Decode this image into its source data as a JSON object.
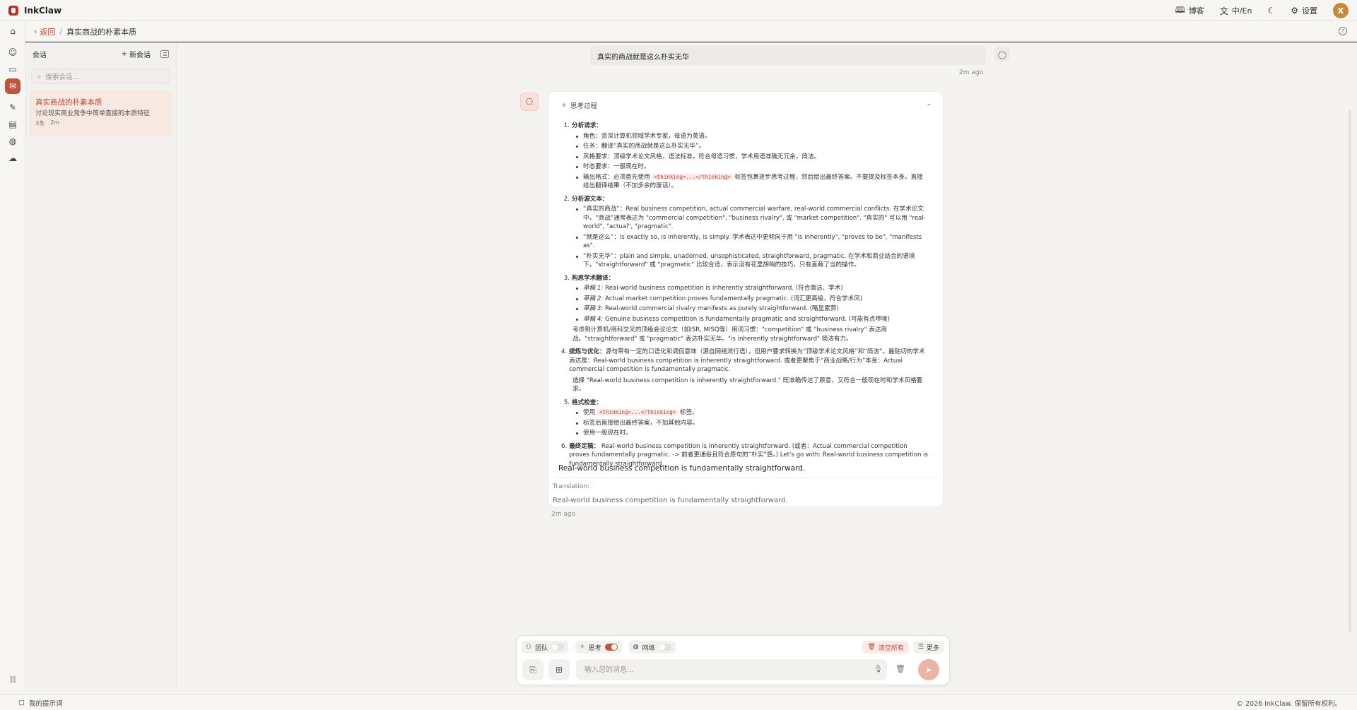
{
  "app": {
    "name": "InkClaw"
  },
  "topbar": {
    "blog_label": "博客",
    "lang_label": "中/En",
    "settings_label": "设置",
    "avatar_initial": "X"
  },
  "breadcrumb": {
    "back_label": "返回",
    "separator": "/",
    "title": "真实商战的朴素本质"
  },
  "sessions": {
    "header": "会话",
    "new_label": "新会话",
    "search_placeholder": "搜索会话...",
    "items": [
      {
        "title": "真实商战的朴素本质",
        "desc": "讨论现实商业竞争中简单直接的本质特征",
        "count": "3条",
        "time": "2m"
      }
    ]
  },
  "chat": {
    "user_message": "真实的商战就是这么朴实无华",
    "user_time": "2m ago",
    "thinking_label": "思考过程",
    "thinking": {
      "s1_title": "分析请求：",
      "s1_items": [
        "角色：资深计算机领域学术专家，母语为英语。",
        "任务：翻译“真实的商战就是这么朴实无华”。",
        "风格要求：顶级学术论文风格，语法标准，符合母语习惯，学术用语准确无冗余，简洁。",
        "时态要求：一般现在时。"
      ],
      "s1_fmt_a": "输出格式：必须首先使用",
      "s1_fmt_tag": "<thinking>...</thinking>",
      "s1_fmt_b": "标签包裹逐步思考过程，然后给出最终答案。不要提及标签本身。直接给出翻译结果（不加多余的废话）。",
      "s2_title": "分析源文本：",
      "s2_items": [
        "“真实的商战”：Real business competition, actual commercial warfare, real-world commercial conflicts. 在学术论文中，“商战”通常表达为 \"commercial competition\", \"business rivalry\", 或 \"market competition\". \"真实的\" 可以用 \"real-world\", \"actual\", \"pragmatic\".",
        "“就是这么”：is exactly so, is inherently, is simply. 学术表达中更倾向于用 \"is inherently\", \"proves to be\", \"manifests as\".",
        "“朴实无华”：plain and simple, unadorned, unsophisticated, straightforward, pragmatic. 在学术和商业结合的语境下，\"straightforward\" 或 \"pragmatic\" 比较合适，表示没有花里胡哨的技巧，只有直截了当的操作。"
      ],
      "s3_title": "构思学术翻译：",
      "s3_items": [
        {
          "tag": "草稿 1:",
          "text": "Real-world business competition is inherently straightforward. (符合简洁、学术)"
        },
        {
          "tag": "草稿 2:",
          "text": "Actual market competition proves fundamentally pragmatic. (词汇更高级，符合学术风)"
        },
        {
          "tag": "草稿 3:",
          "text": "Real-world commercial rivalry manifests as purely straightforward. (略显累赘)"
        },
        {
          "tag": "草稿 4:",
          "text": "Genuine business competition is fundamentally pragmatic and straightforward. (可能有点啰嗦)"
        }
      ],
      "s3_para": "考虑到计算机/商科交叉的顶级会议论文（如ISR, MISQ等）用词习惯：\"competition\" 或 \"business rivalry\" 表达商战。\"straightforward\" 或 \"pragmatic\" 表达朴实无华。\"is inherently straightforward\" 简洁有力。",
      "s4_title": "提炼与优化：",
      "s4_text": "源句带有一定的口语化和调侃意味（源自网络流行语），但用户要求转换为“顶级学术论文风格”和“简洁”。最贴切的学术表达是：Real-world business competition is inherently straightforward. 或者更聚焦于“商业战略/行为”本身：Actual commercial competition is fundamentally pragmatic.",
      "s4_para": "选择 \"Real-world business competition is inherently straightforward.\" 既准确传达了原意，又符合一般现在时和学术风格要求。",
      "s5_title": "格式检查：",
      "s5_item1_a": "使用",
      "s5_item1_tag": "<thinking>...</thinking>",
      "s5_item1_b": "标签。",
      "s5_items": [
        "标签后直接给出最终答案，不加其他内容。",
        "使用一般现在时。"
      ],
      "s6_title": "最终定稿：",
      "s6_text": "Real-world business competition is inherently straightforward. (或者：Actual commercial competition proves fundamentally pragmatic. -> 前者更通俗且符合原句的“朴实”感。) Let's go with: Real-world business competition is fundamentally straightforward."
    },
    "answer": "Real-world business competition is fundamentally straightforward.",
    "translation_label": "Translation:",
    "translation_text": "Real-world business competition is fundamentally straightforward.",
    "bot_time": "2m ago"
  },
  "composer": {
    "team_label": "团队",
    "think_label": "思考",
    "web_label": "网络",
    "team_on": false,
    "think_on": true,
    "web_on": false,
    "clear_label": "清空所有",
    "more_label": "更多",
    "placeholder": "输入您的消息..."
  },
  "footer": {
    "prompts_label": "我的提示词",
    "copyright": "© 2026 InkClaw. 保留所有权利。"
  },
  "colors": {
    "accent": "#c0553f",
    "brand": "#b82e24"
  }
}
